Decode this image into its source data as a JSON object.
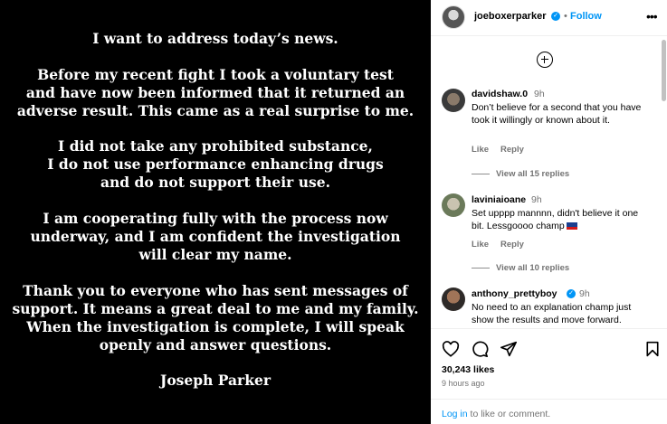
{
  "statement": {
    "lines": [
      "I want to address today’s news.",
      "Before my recent fight I took a voluntary test",
      "and have now been informed that it returned an",
      "adverse result. This came as a real surprise to me.",
      "I did not take any prohibited substance,",
      "I do not use performance enhancing drugs",
      "and do not support their use.",
      "I am cooperating fully with the process now",
      "underway, and I am confident the investigation",
      "will clear my name.",
      "Thank you to everyone who has sent messages of",
      "support. It means a great deal to me and my family.",
      "When the investigation is complete, I will speak",
      "openly and answer questions.",
      "Joseph Parker"
    ]
  },
  "header": {
    "username": "joeboxerparker",
    "separator": "•",
    "follow_label": "Follow",
    "more_icon": "more-horizontal-icon"
  },
  "comments": [
    {
      "username": "davidshaw.0",
      "time": "9h",
      "text": "Don’t believe for a second that you have took it willingly or known about it.",
      "like_label": "Like",
      "reply_label": "Reply",
      "replies_label": "View all 15 replies"
    },
    {
      "username": "laviniaioane",
      "time": "9h",
      "text": "Set upppp mannnn, didn't believe it one bit. Lessgoooo champ",
      "like_label": "Like",
      "reply_label": "Reply",
      "replies_label": "View all 10 replies"
    },
    {
      "username": "anthony_prettyboy",
      "time": "9h",
      "text": "No need to an explanation champ just show the results and move forward."
    }
  ],
  "footer": {
    "likes": "30,243 likes",
    "ago": "9 hours ago",
    "login_link": "Log in",
    "login_rest": " to like or comment."
  },
  "colors": {
    "accent": "#0095f6",
    "muted": "#737373",
    "image_bg": "#000000"
  }
}
